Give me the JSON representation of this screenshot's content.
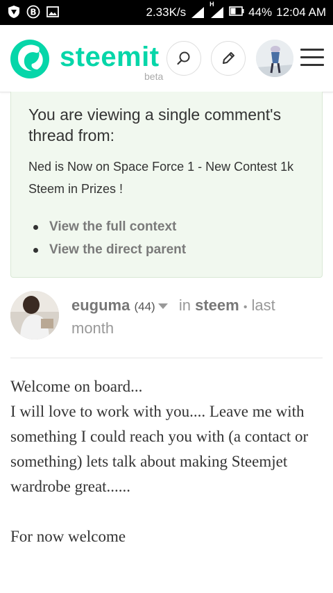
{
  "status_bar": {
    "icons_left": [
      "vpn-icon",
      "bitcoin-icon",
      "image-icon"
    ],
    "network_speed": "2.33K/s",
    "signal_label": "H",
    "battery": "44%",
    "time": "12:04 AM"
  },
  "header": {
    "logo_text": "steemit",
    "logo_badge": "beta",
    "brand_color": "#06d6a9",
    "buttons": [
      "search-icon",
      "pencil-icon",
      "avatar",
      "menu-icon"
    ]
  },
  "info_box": {
    "title": "You are viewing a single comment's thread from:",
    "post_title": "Ned is Now on Space Force 1 - New Contest 1k Steem in Prizes !",
    "links": [
      "View the full context",
      "View the direct parent"
    ]
  },
  "comment": {
    "author": "euguma",
    "reputation": "(44)",
    "in_label": "in",
    "tag": "steem",
    "separator": "•",
    "time": "last month",
    "body": [
      "Welcome on board...",
      "I will love to work with you.... Leave me with something I could reach you with (a contact or something) lets talk about making Steemjet wardrobe great......",
      "",
      "For now welcome"
    ]
  }
}
